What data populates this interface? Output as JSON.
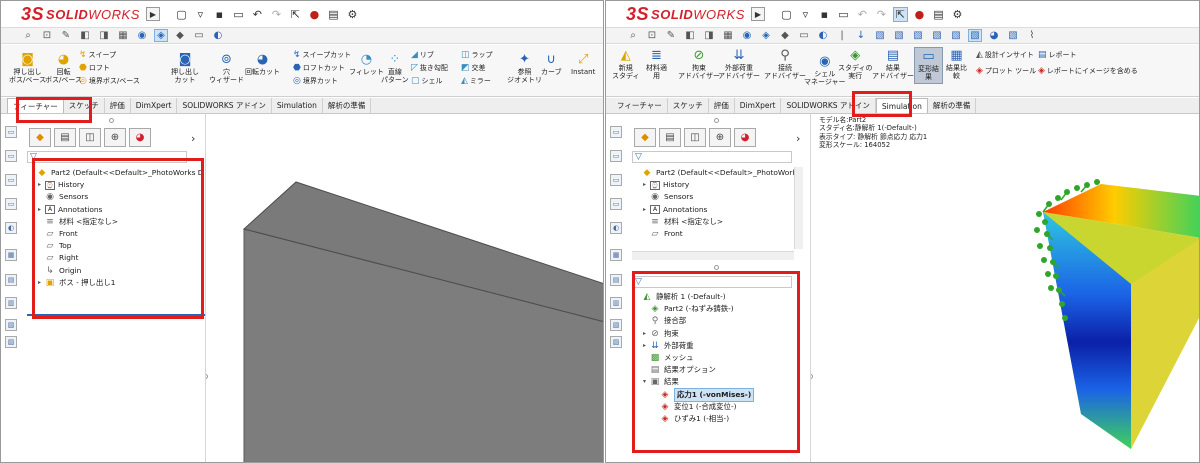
{
  "brand": {
    "ds": "3S",
    "solid": "SOLID",
    "works": "WORKS"
  },
  "left": {
    "ribbon": {
      "boss_extrude": "押し出し\nボス/ベース",
      "revolve_boss": "回転\nボス/ベース",
      "sweep": "スイープ",
      "loft": "ロフト",
      "boundary_boss": "境界ボス/ベース",
      "extruded_cut": "押し出し\nカット",
      "hole_wizard": "穴\nウィザード",
      "revolved_cut": "回転カット",
      "sweep_cut": "スイープカット",
      "loft_cut": "ロフトカット",
      "boundary_cut": "境界カット",
      "fillet": "フィレット",
      "linear_pattern": "直線\nパターン",
      "rib": "リブ",
      "draft": "抜き勾配",
      "shell": "シェル",
      "wrap": "ラップ",
      "intersect": "交差",
      "mirror": "ミラー",
      "reference_geometry": "参照\nジオメトリ",
      "curves": "カーブ",
      "instant3d": "Instant"
    },
    "tabs": [
      "フィーチャー",
      "スケッチ",
      "評価",
      "DimXpert",
      "SOLIDWORKS アドイン",
      "Simulation",
      "解析の準備"
    ],
    "active_tab": 0,
    "tree": [
      {
        "label": "Part2  (Default<<Default>_PhotoWorks D",
        "icon": "part-icon",
        "glyph": "◆"
      },
      {
        "label": "History",
        "icon": "history-icon",
        "glyph": "⌚"
      },
      {
        "label": "Sensors",
        "icon": "sensors-icon",
        "glyph": "◉"
      },
      {
        "label": "Annotations",
        "icon": "annotations-icon",
        "glyph": "A"
      },
      {
        "label": "材料 <指定なし>",
        "icon": "material-icon",
        "glyph": "≡"
      },
      {
        "label": "Front",
        "icon": "plane-icon",
        "glyph": "▱"
      },
      {
        "label": "Top",
        "icon": "plane-icon",
        "glyph": "▱"
      },
      {
        "label": "Right",
        "icon": "plane-icon",
        "glyph": "▱"
      },
      {
        "label": "Origin",
        "icon": "origin-icon",
        "glyph": "↳"
      },
      {
        "label": "ボス - 押し出し1",
        "icon": "extrude-icon",
        "glyph": "▣"
      }
    ]
  },
  "right": {
    "ribbon": {
      "new_study": "新規\nスタディ",
      "apply_material": "材料適\n用",
      "connections_advisor": "拘束\nアドバイザー",
      "external_loads": "外部荷重\nアドバイザー",
      "connections": "接続\nアドバイザー",
      "shell_manager": "シェル\nマネージャー",
      "run_study": "スタディの\n実行",
      "results_advisor": "結果\nアドバイザー",
      "deformed_result": "変形結\n果",
      "compare_results": "結果比\n較",
      "design_insight": "設計インサイト",
      "plot_tools": "プロット ツール",
      "report": "レポート",
      "include_image": "レポートにイメージを含める"
    },
    "tabs": [
      "フィーチャー",
      "スケッチ",
      "評価",
      "DimXpert",
      "SOLIDWORKS アドイン",
      "Simulation",
      "解析の準備"
    ],
    "active_tab": 5,
    "tree_top": [
      {
        "label": "Part2  (Default<<Default>_PhotoWorks",
        "icon": "part-icon",
        "glyph": "◆"
      },
      {
        "label": "History",
        "icon": "history-icon",
        "glyph": "⌚"
      },
      {
        "label": "Sensors",
        "icon": "sensors-icon",
        "glyph": "◉"
      },
      {
        "label": "Annotations",
        "icon": "annotations-icon",
        "glyph": "A"
      },
      {
        "label": "材料 <指定なし>",
        "icon": "material-icon",
        "glyph": "≡"
      },
      {
        "label": "Front",
        "icon": "plane-icon",
        "glyph": "▱"
      }
    ],
    "sim_tree": [
      {
        "label": "静解析 1 (-Default-)",
        "icon": "static-study-icon",
        "glyph": "◭"
      },
      {
        "label": "Part2 (-ねずみ鋳鉄-)",
        "icon": "part-material-icon",
        "glyph": "◈"
      },
      {
        "label": "接合部",
        "icon": "connections-icon",
        "glyph": "⚲"
      },
      {
        "label": "拘束",
        "icon": "fixtures-icon",
        "glyph": "⊘"
      },
      {
        "label": "外部荷重",
        "icon": "external-loads-icon",
        "glyph": "⇊"
      },
      {
        "label": "メッシュ",
        "icon": "mesh-icon",
        "glyph": "▩"
      },
      {
        "label": "結果オプション",
        "icon": "result-options-icon",
        "glyph": "▤"
      },
      {
        "label": "結果",
        "icon": "results-folder-icon",
        "glyph": "▣"
      },
      {
        "label": "応力1 (-vonMises-)",
        "icon": "stress-plot-icon",
        "glyph": "◈"
      },
      {
        "label": "変位1 (-合成変位-)",
        "icon": "displacement-plot-icon",
        "glyph": "◈"
      },
      {
        "label": "ひずみ1 (-相当-)",
        "icon": "strain-plot-icon",
        "glyph": "◈"
      }
    ],
    "sim_info": [
      "モデル名:Part2",
      "スタディ名:静解析 1(-Default-)",
      "表示タイプ: 静解析 節点応力 応力1",
      "変形スケール: 164052"
    ]
  }
}
